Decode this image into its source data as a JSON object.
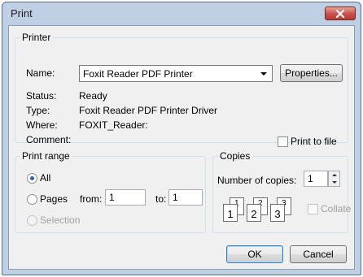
{
  "window": {
    "title": "Print"
  },
  "printer": {
    "group_label": "Printer",
    "name_label": "Name:",
    "name_value": "Foxit Reader PDF Printer",
    "properties_label": "Properties...",
    "status_label": "Status:",
    "status_value": "Ready",
    "type_label": "Type:",
    "type_value": "Foxit Reader PDF Printer Driver",
    "where_label": "Where:",
    "where_value": "FOXIT_Reader:",
    "comment_label": "Comment:",
    "print_to_file_label": "Print to file",
    "print_to_file_checked": false
  },
  "print_range": {
    "group_label": "Print range",
    "all_label": "All",
    "pages_label": "Pages",
    "from_label": "from:",
    "from_value": "1",
    "to_label": "to:",
    "to_value": "1",
    "selection_label": "Selection",
    "selected": "All"
  },
  "copies": {
    "group_label": "Copies",
    "number_label": "Number of copies:",
    "number_value": "1",
    "collate_label": "Collate",
    "collate_checked": false,
    "pages": [
      "1",
      "2",
      "3"
    ]
  },
  "buttons": {
    "ok": "OK",
    "cancel": "Cancel"
  },
  "icons": {
    "close": "close-icon",
    "spin_up": "arrow-up-icon",
    "spin_down": "arrow-down-icon"
  },
  "colors": {
    "close_button": "#c75050",
    "frame": "#bfcfe4",
    "client": "#f0f0f0"
  }
}
